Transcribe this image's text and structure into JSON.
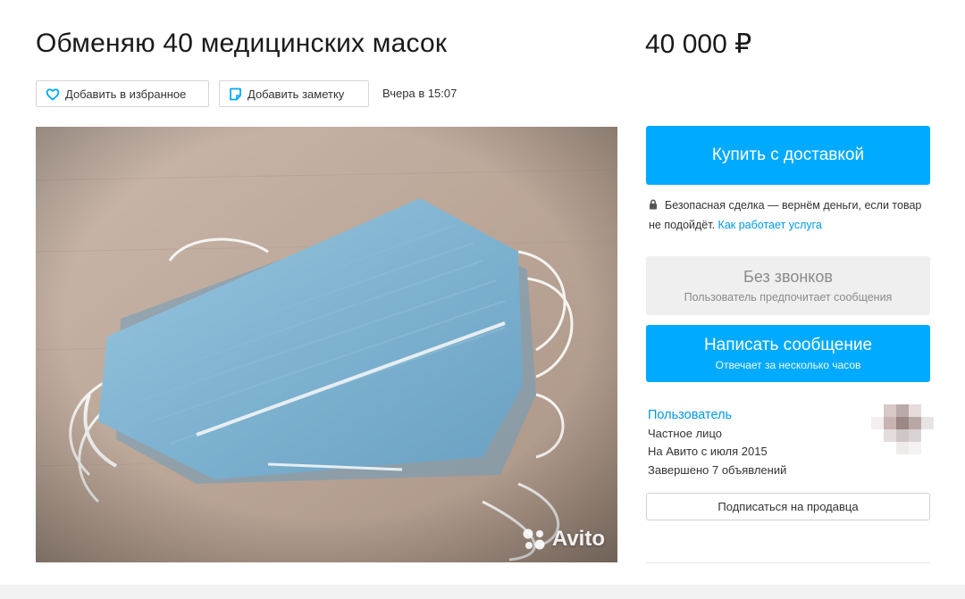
{
  "listing": {
    "title": "Обменяю 40 медицинских масок",
    "price": "40 000 ₽",
    "posted": "Вчера в 15:07"
  },
  "actions": {
    "favorite_label": "Добавить в избранное",
    "note_label": "Добавить заметку"
  },
  "photo": {
    "watermark": "Avito"
  },
  "purchase": {
    "buy_label": "Купить с доставкой",
    "safe_deal_text": "Безопасная сделка — вернём деньги, если товар не подойдёт.",
    "safe_deal_link": "Как работает услуга"
  },
  "contact": {
    "no_calls_title": "Без звонков",
    "no_calls_sub": "Пользователь предпочитает сообщения",
    "message_label": "Написать сообщение",
    "message_sub": "Отвечает за несколько часов"
  },
  "seller": {
    "name": "Пользователь",
    "type": "Частное лицо",
    "since": "На Авито с июля 2015",
    "completed": "Завершено 7 объявлений",
    "subscribe_label": "Подписаться на продавца"
  },
  "colors": {
    "accent": "#00aaff",
    "link": "#0099e6",
    "muted_button": "#efefef"
  },
  "icons": [
    "heart-icon",
    "note-icon",
    "lock-icon",
    "avito-logo-icon"
  ]
}
